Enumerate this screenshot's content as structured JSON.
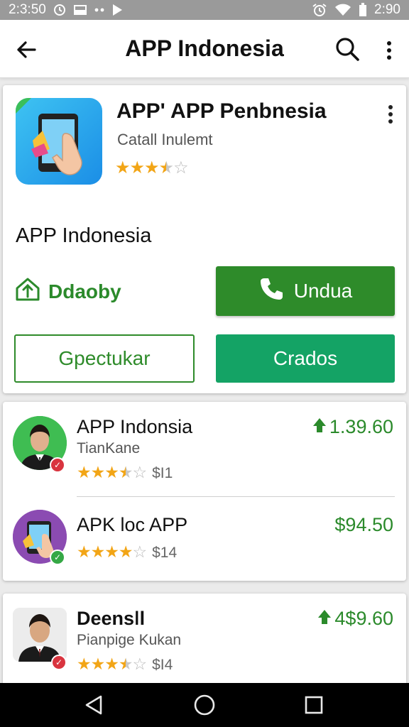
{
  "status_bar": {
    "time_left": "2:3:50",
    "time_right": "2:90",
    "icons": [
      "clock-icon",
      "screenshot-icon",
      "more-dots-icon",
      "play-icon",
      "alarm-icon",
      "wifi-icon",
      "battery-icon"
    ]
  },
  "app_bar": {
    "title": "APP Indonesia",
    "icons": [
      "back-arrow-icon",
      "search-icon",
      "more-vert-icon"
    ]
  },
  "detail": {
    "title": "APP' APP Penbnesia",
    "subtitle": "Catall Inulemt",
    "rating": 3.5,
    "app_name": "APP Indonesia",
    "developer_label": "Ddaoby",
    "install_label": "Undua",
    "secondary_label": "Gpectukar",
    "primary_label": "Crados"
  },
  "list": [
    {
      "title": "APP Indonsia",
      "subtitle": "TianKane",
      "rating": 3.5,
      "count": "$I1",
      "price": "1.39.60",
      "price_icon": "up-arrow-icon",
      "badge_color": "#d9343f"
    },
    {
      "title": "APK loc APP",
      "subtitle": "",
      "rating": 4,
      "count": "$14",
      "price": "$94.50",
      "price_icon": "",
      "badge_color": "#35a845"
    },
    {
      "title": "Deensǀl",
      "subtitle": "Pianpige Kukan",
      "rating": 3.5,
      "count": "$I4",
      "price": "4$9.60",
      "price_icon": "up-arrow-icon",
      "badge_color": "#d9343f"
    }
  ],
  "colors": {
    "accent_green": "#2e8b2a",
    "primary_green": "#14a365",
    "star": "#f2a516"
  }
}
